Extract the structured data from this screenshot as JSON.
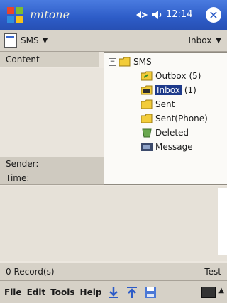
{
  "titlebar": {
    "app_title": "mitone",
    "time": "12:14",
    "close_label": "✕"
  },
  "toolbar": {
    "folder_menu": "SMS",
    "view_menu": "Inbox"
  },
  "list": {
    "column_header": "Content"
  },
  "details": {
    "sender_label": "Sender:",
    "time_label": "Time:"
  },
  "status": {
    "records": "0 Record(s)",
    "right_text": "Test"
  },
  "menubar": {
    "items": [
      "File",
      "Edit",
      "Tools",
      "Help"
    ]
  },
  "folder_tree": {
    "root": "SMS",
    "items": [
      {
        "label": "Outbox",
        "count": "(5)"
      },
      {
        "label": "Inbox",
        "count": "(1)"
      },
      {
        "label": "Sent",
        "count": ""
      },
      {
        "label": "Sent(Phone)",
        "count": ""
      },
      {
        "label": "Deleted",
        "count": ""
      },
      {
        "label": "Message",
        "count": ""
      }
    ]
  },
  "colors": {
    "title_bar": "#2d5cc7",
    "selection": "#1e3a8a",
    "background": "#ece7df"
  }
}
